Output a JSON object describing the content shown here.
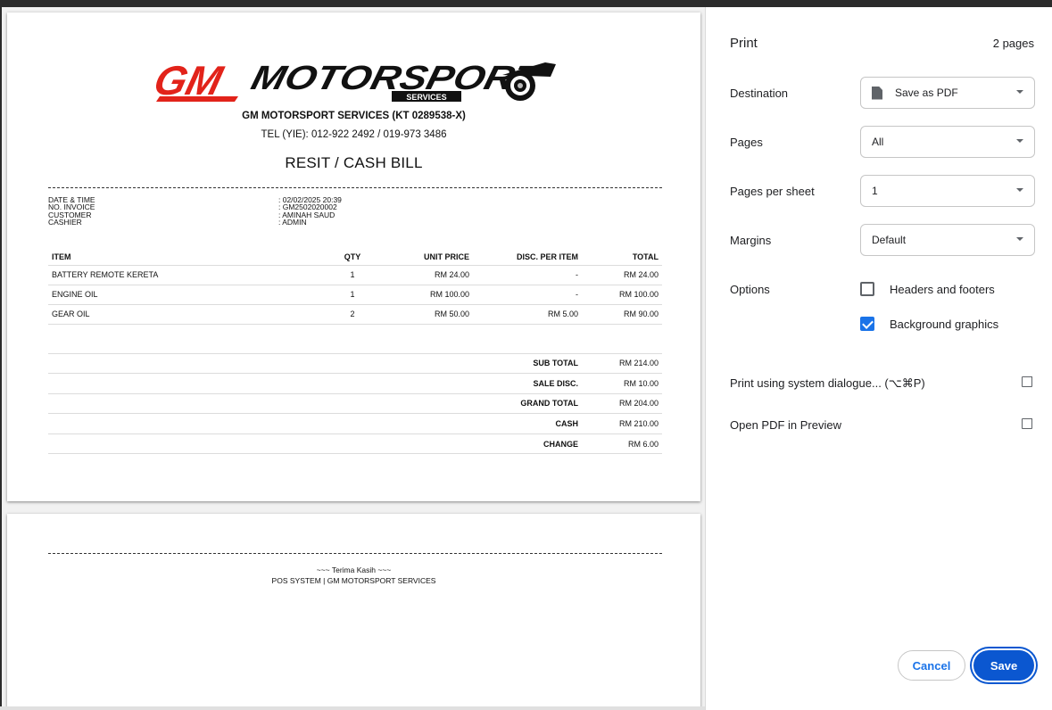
{
  "receipt": {
    "logo_main": "GM",
    "logo_word": "MOTORSPORT",
    "logo_sub": "SERVICES",
    "company_name": "GM MOTORSPORT SERVICES (KT 0289538-X)",
    "tel": "TEL (YIE): 012-922 2492 / 019-973 3486",
    "title": "RESIT / CASH BILL",
    "info": [
      {
        "label": "DATE & TIME",
        "value": ": 02/02/2025 20:39"
      },
      {
        "label": "NO. INVOICE",
        "value": ": GM2502020002"
      },
      {
        "label": "CUSTOMER",
        "value": ": AMINAH SAUD"
      },
      {
        "label": "CASHIER",
        "value": ": ADMIN"
      }
    ],
    "columns": [
      "ITEM",
      "QTY",
      "UNIT PRICE",
      "DISC. PER ITEM",
      "TOTAL"
    ],
    "items": [
      {
        "item": "BATTERY REMOTE KERETA",
        "qty": "1",
        "price": "RM 24.00",
        "disc": "-",
        "total": "RM 24.00"
      },
      {
        "item": "ENGINE OIL",
        "qty": "1",
        "price": "RM 100.00",
        "disc": "-",
        "total": "RM 100.00"
      },
      {
        "item": "GEAR OIL",
        "qty": "2",
        "price": "RM 50.00",
        "disc": "RM 5.00",
        "total": "RM 90.00"
      }
    ],
    "totals": [
      {
        "label": "SUB TOTAL",
        "value": "RM 214.00"
      },
      {
        "label": "SALE DISC.",
        "value": "RM 10.00"
      },
      {
        "label": "GRAND TOTAL",
        "value": "RM 204.00"
      },
      {
        "label": "CASH",
        "value": "RM 210.00"
      },
      {
        "label": "CHANGE",
        "value": "RM 6.00"
      }
    ],
    "thanks": "~~~ Terima Kasih ~~~",
    "footer": "POS SYSTEM | GM MOTORSPORT SERVICES"
  },
  "panel": {
    "title": "Print",
    "page_count": "2 pages",
    "destination_label": "Destination",
    "destination_value": "Save as PDF",
    "pages_label": "Pages",
    "pages_value": "All",
    "pps_label": "Pages per sheet",
    "pps_value": "1",
    "margins_label": "Margins",
    "margins_value": "Default",
    "options_label": "Options",
    "headers_footers_label": "Headers and footers",
    "headers_footers_checked": false,
    "bg_graphics_label": "Background graphics",
    "bg_graphics_checked": true,
    "system_dialog_label": "Print using system dialogue... (⌥⌘P)",
    "open_pdf_label": "Open PDF in Preview",
    "cancel_label": "Cancel",
    "save_label": "Save"
  },
  "colors": {
    "logo_red": "#e2231a",
    "primary_blue": "#0b57d0"
  }
}
